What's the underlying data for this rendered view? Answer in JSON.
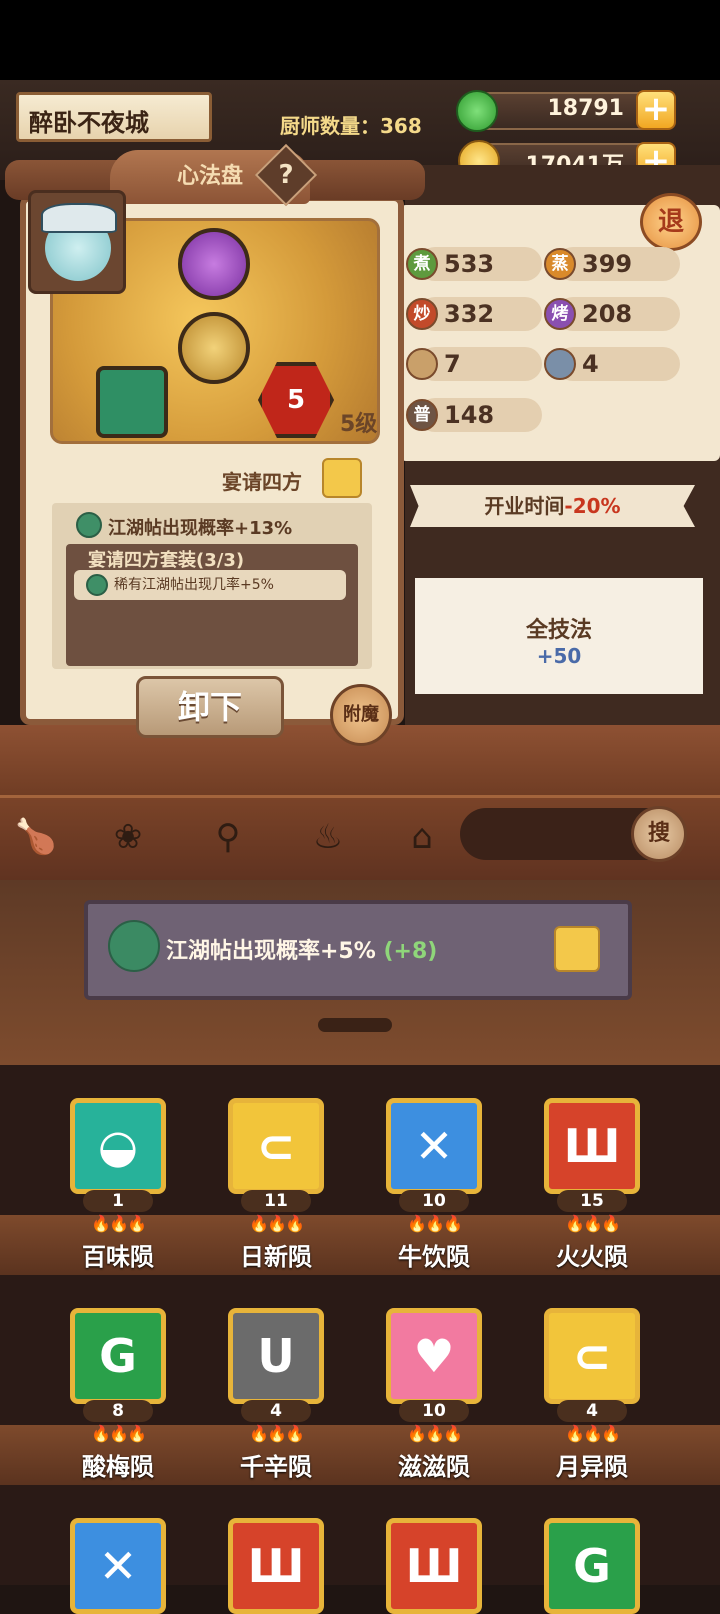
{
  "header": {
    "restaurant_name": "醉卧不夜城",
    "chef_count_label": "厨师数量：368",
    "jade_amount": "18791",
    "coin_amount": "17041万",
    "plus_symbol": "+"
  },
  "exit_label": "退",
  "stats": [
    {
      "glyph": "煮",
      "value": "533",
      "color": "#5e9a3e"
    },
    {
      "glyph": "蒸",
      "value": "399",
      "color": "#d98a2b"
    },
    {
      "glyph": "炒",
      "value": "332",
      "color": "#c24a2a"
    },
    {
      "glyph": "烤",
      "value": "208",
      "color": "#8a4fb0"
    },
    {
      "glyph": "",
      "value": "7",
      "color": "#c9a06a"
    },
    {
      "glyph": "",
      "value": "4",
      "color": "#7a8fa8"
    },
    {
      "glyph": "普",
      "value": "148",
      "color": "#6e5444"
    }
  ],
  "banner_open_time": {
    "text": "开业时间",
    "value": "-20%"
  },
  "banner_all_skill": {
    "title": "全技法",
    "value": "+50"
  },
  "panel": {
    "title": "心法盘",
    "help": "?",
    "level": "5级",
    "gem_level": "5",
    "set_name": "宴请四方",
    "effect_1": "江湖帖出现概率+13%",
    "set_title": "宴请四方套装(3/3)",
    "set_effect": "稀有江湖帖出现几率+5%",
    "unload_label": "卸下",
    "enchant_label": "附魔"
  },
  "search": {
    "label": "搜"
  },
  "board": {
    "text": "江湖帖出现概率+5%",
    "bonus": "(+8)"
  },
  "items": [
    {
      "name": "百味陨",
      "count": "1",
      "color": "#27b29a",
      "symbol": "◒"
    },
    {
      "name": "日新陨",
      "count": "11",
      "color": "#f2c53a",
      "symbol": "⊂"
    },
    {
      "name": "牛饮陨",
      "count": "10",
      "color": "#3d8fe0",
      "symbol": "✕"
    },
    {
      "name": "火火陨",
      "count": "15",
      "color": "#d6432a",
      "symbol": "Ш"
    },
    {
      "name": "酸梅陨",
      "count": "8",
      "color": "#2aa04a",
      "symbol": "G"
    },
    {
      "name": "千辛陨",
      "count": "4",
      "color": "#6b6b6b",
      "symbol": "U"
    },
    {
      "name": "滋滋陨",
      "count": "10",
      "color": "#f27aa0",
      "symbol": "♥"
    },
    {
      "name": "月异陨",
      "count": "4",
      "color": "#f2c53a",
      "symbol": "⊂"
    },
    {
      "name": "",
      "count": "",
      "color": "#3d8fe0",
      "symbol": "✕"
    },
    {
      "name": "",
      "count": "",
      "color": "#d6432a",
      "symbol": "Ш"
    },
    {
      "name": "",
      "count": "",
      "color": "#d6432a",
      "symbol": "Ш"
    },
    {
      "name": "",
      "count": "",
      "color": "#2aa04a",
      "symbol": "G"
    }
  ],
  "flames": "🔥🔥🔥",
  "toolbar_icons": [
    "drumstick-icon",
    "dumpling-icon",
    "pan-icon",
    "fire-icon",
    "home-icon"
  ]
}
